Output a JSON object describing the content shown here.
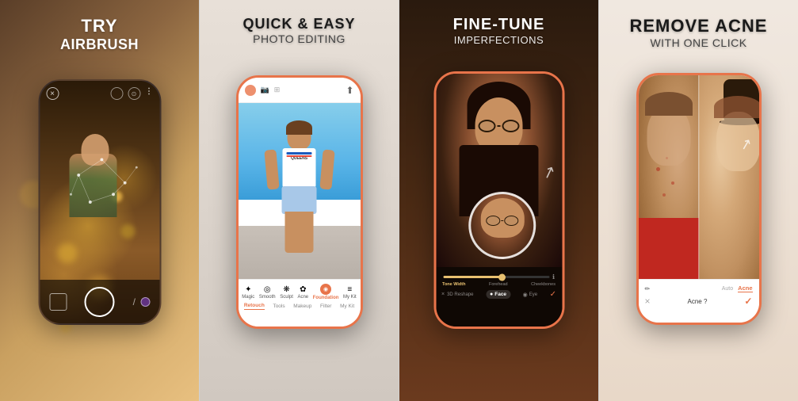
{
  "panels": [
    {
      "id": "panel-1",
      "title_line1": "TRY",
      "title_line2": "AIRBRUSH",
      "bg_type": "bokeh_portrait",
      "bottom_items": [
        "square-icon",
        "phone-icon",
        "slash-icon",
        "dot-icon"
      ]
    },
    {
      "id": "panel-2",
      "title_line1": "QUICK & EASY",
      "title_line2": "PHOTO EDITING",
      "bg_type": "fashion_photo",
      "tab_items": [
        {
          "icon": "✦",
          "label": "Magic"
        },
        {
          "icon": "◎",
          "label": "Smooth"
        },
        {
          "icon": "◉",
          "label": "Sculpt"
        },
        {
          "icon": "✿",
          "label": "Acne"
        },
        {
          "icon": "⬟",
          "label": "Foundation",
          "active": true
        },
        {
          "icon": "≡",
          "label": "My Kit"
        }
      ],
      "active_tabs": [
        "Retouch",
        "Tools",
        "Makeup",
        "Filter",
        "My Kit"
      ],
      "active_tab": "Retouch"
    },
    {
      "id": "panel-3",
      "title_line1": "FINE-TUNE",
      "title_line2": "IMPERFECTIONS",
      "bg_type": "portrait_closeup",
      "slider_labels": [
        "Tone Width",
        "Forehead",
        "Cheekbones"
      ],
      "active_slider": "Tone Width",
      "mode_tabs": [
        "3D Reshape",
        "Face",
        "Eye"
      ],
      "active_mode": "Face"
    },
    {
      "id": "panel-4",
      "title_line1": "REMOVE ACNE",
      "title_line2": "WITH ONE CLICK",
      "bg_type": "before_after",
      "acne_options": [
        "Auto",
        "Acne"
      ],
      "active_option": "Acne",
      "question_label": "Acne ?"
    }
  ]
}
